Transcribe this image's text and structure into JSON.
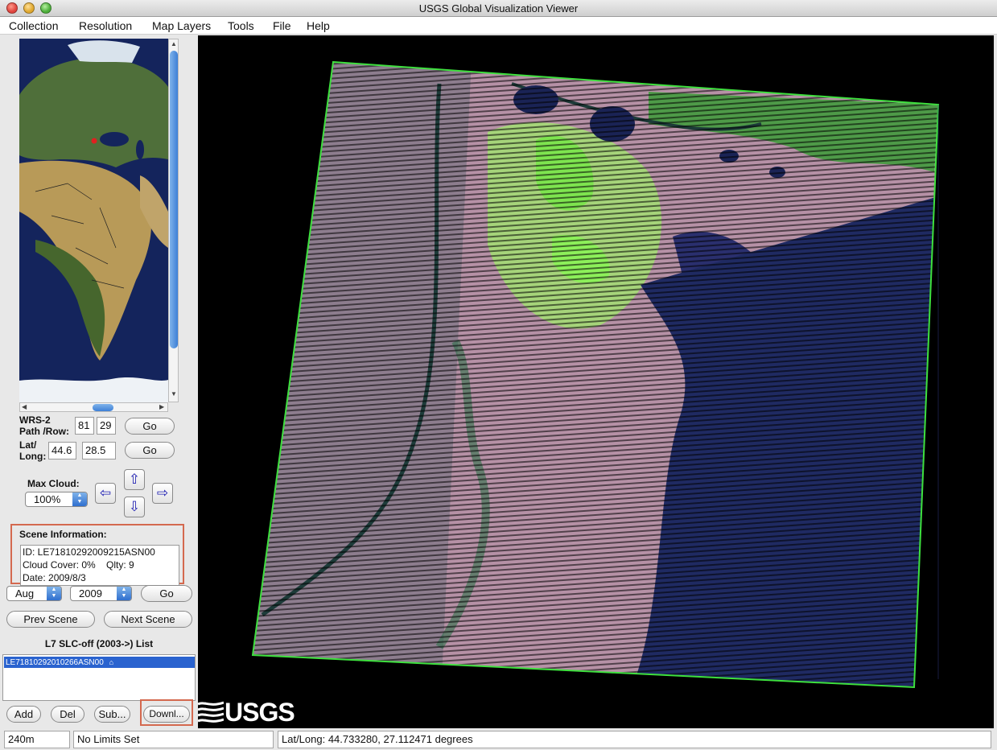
{
  "window": {
    "title": "USGS Global Visualization Viewer"
  },
  "menu": [
    "Collection",
    "Resolution",
    "Map Layers",
    "Tools",
    "File",
    "Help"
  ],
  "navigation": {
    "wrs_label_1": "WRS-2",
    "wrs_label_2": "Path /Row:",
    "path_value": "81",
    "row_value": "29",
    "go_label": "Go",
    "latlong_label_1": "Lat/",
    "latlong_label_2": "Long:",
    "lat_value": "44.6",
    "long_value": "28.5",
    "max_cloud_label": "Max Cloud:",
    "max_cloud_value": "100%"
  },
  "scene_info": {
    "title": "Scene Information:",
    "id_line": "ID: LE71810292009215ASN00",
    "cloud_line": "Cloud Cover: 0%    Qlty: 9",
    "date_line": "Date: 2009/8/3"
  },
  "date_select": {
    "month": "Aug",
    "year": "2009",
    "go_label": "Go"
  },
  "scene_nav": {
    "prev_label": "Prev Scene",
    "next_label": "Next Scene"
  },
  "scene_list": {
    "title": "L7 SLC-off (2003->) List",
    "items": [
      "LE71810292010266ASN00"
    ]
  },
  "list_buttons": {
    "add": "Add",
    "del": "Del",
    "sub": "Sub...",
    "download": "Downl..."
  },
  "logo_text": "USGS",
  "status": {
    "resolution": "240m",
    "limits": "No Limits Set",
    "latlong": "Lat/Long:  44.733280,  27.112471 degrees"
  },
  "colors": {
    "highlight": "#d4694f",
    "scene_outline": "#3ee03e",
    "selection": "#2a63cf"
  }
}
